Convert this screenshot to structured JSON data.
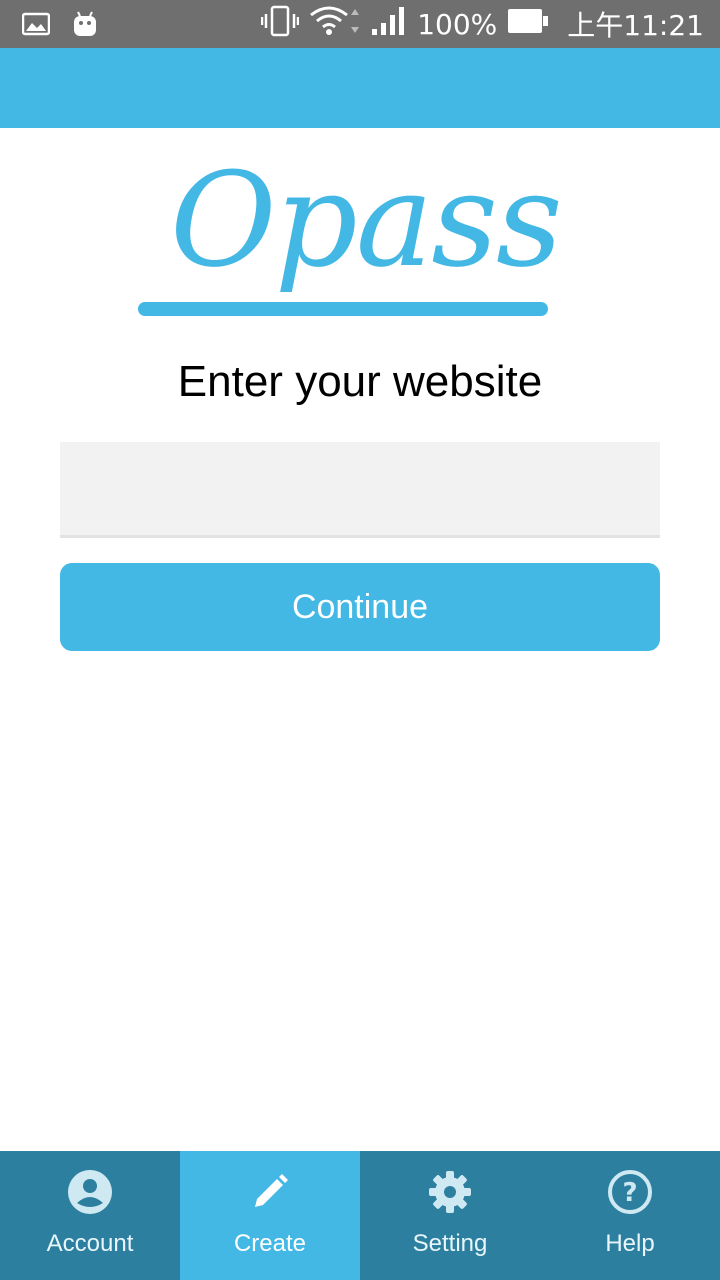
{
  "status_bar": {
    "battery": "100%",
    "time": "上午11:21",
    "icons": [
      "image-icon",
      "android-icon",
      "vibrate-icon",
      "wifi-icon",
      "signal-icon",
      "battery-icon"
    ]
  },
  "logo": {
    "text": "Opass",
    "color": "#43b8e5"
  },
  "main": {
    "prompt": "Enter your website",
    "website_input": {
      "value": "",
      "placeholder": ""
    },
    "continue_label": "Continue"
  },
  "bottom_nav": {
    "items": [
      {
        "label": "Account",
        "icon": "account-icon",
        "active": false
      },
      {
        "label": "Create",
        "icon": "pencil-icon",
        "active": true
      },
      {
        "label": "Setting",
        "icon": "gear-icon",
        "active": false
      },
      {
        "label": "Help",
        "icon": "help-icon",
        "active": false
      }
    ]
  },
  "colors": {
    "accent": "#43b8e5",
    "nav_background": "#2d7f9f",
    "status_bar": "#6f6f6f"
  }
}
